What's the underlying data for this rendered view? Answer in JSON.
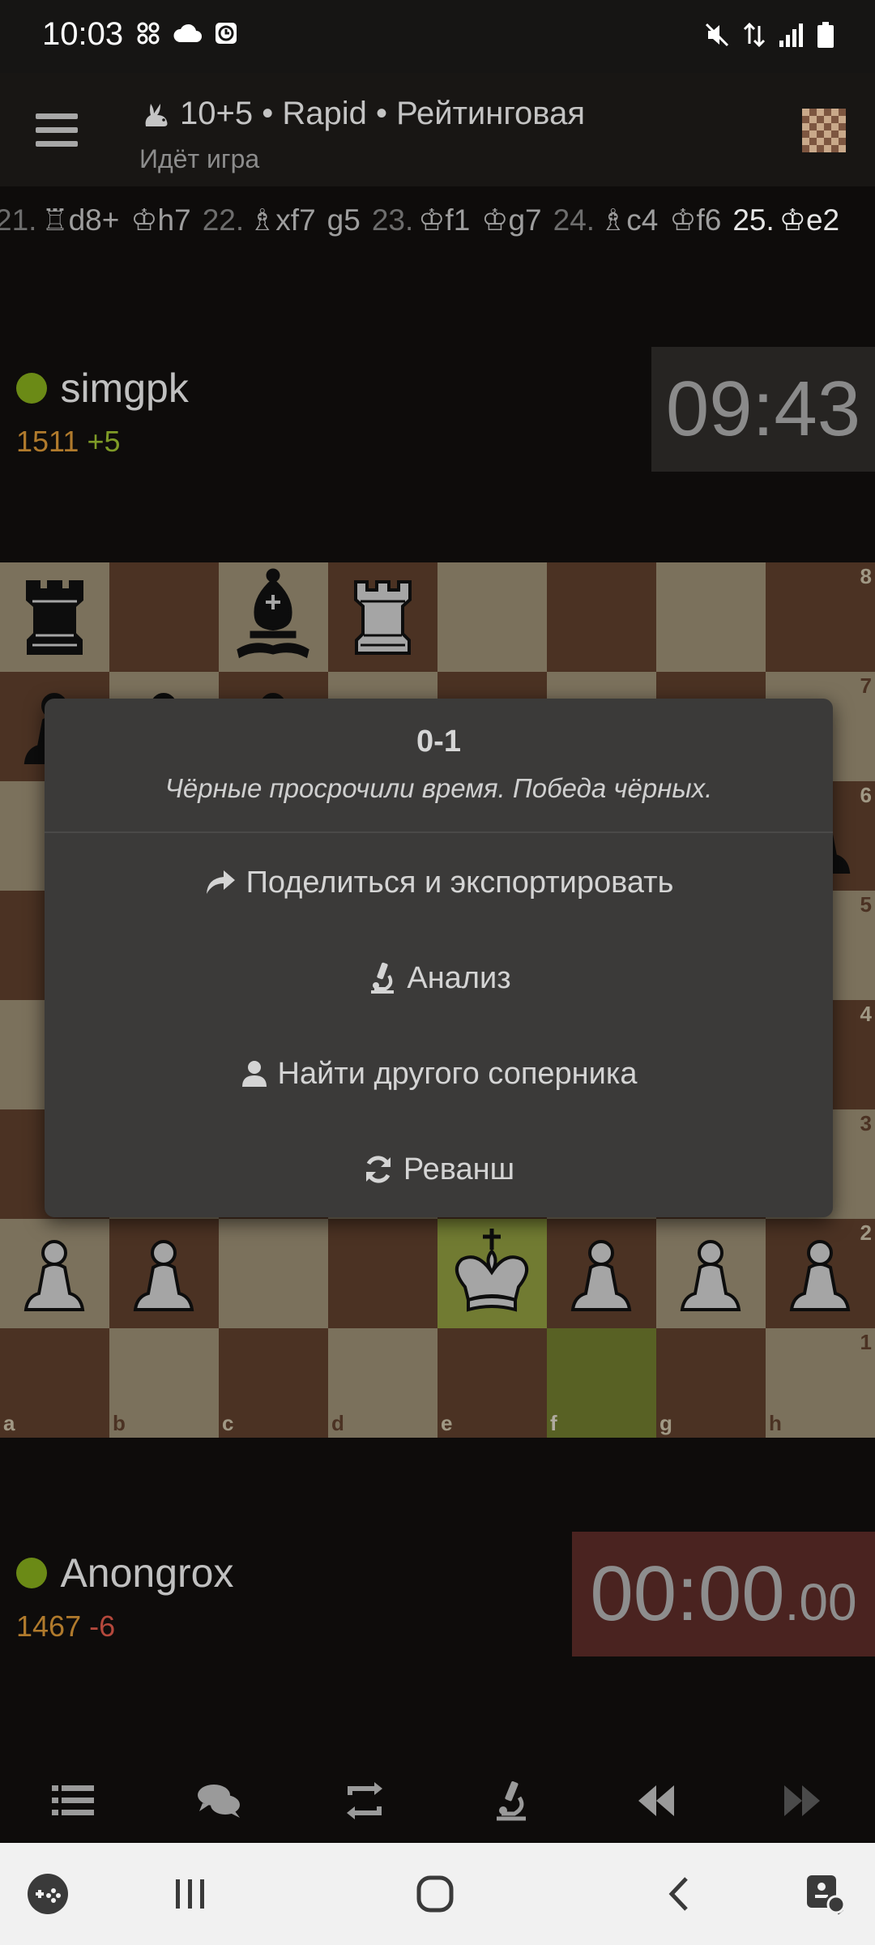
{
  "status_bar": {
    "time": "10:03"
  },
  "header": {
    "title": "10+5 • Rapid • Рейтинговая",
    "subtitle": "Идёт игра"
  },
  "moves": [
    {
      "num": "21.",
      "white": "♖d8+",
      "black": "♔h7"
    },
    {
      "num": "22.",
      "white": "♗xf7",
      "black": "g5"
    },
    {
      "num": "23.",
      "white": "♔f1",
      "black": "♔g7"
    },
    {
      "num": "24.",
      "white": "♗c4",
      "black": "♔f6"
    },
    {
      "num": "25.",
      "white": "♔e2",
      "black": ""
    }
  ],
  "top_player": {
    "name": "simgpk",
    "rating": "1511",
    "delta": "+5",
    "clock": "09:43"
  },
  "bottom_player": {
    "name": "Anongrox",
    "rating": "1467",
    "delta": "-6",
    "clock_main": "00:00",
    "clock_cent": ".00"
  },
  "board": {
    "files": [
      "a",
      "b",
      "c",
      "d",
      "e",
      "f",
      "g",
      "h"
    ],
    "ranks": [
      "8",
      "7",
      "6",
      "5",
      "4",
      "3",
      "2",
      "1"
    ]
  },
  "modal": {
    "result": "0-1",
    "reason": "Чёрные просрочили время. Победа чёрных.",
    "share_label": "Поделиться и экспортировать",
    "analysis_label": "Анализ",
    "new_opponent_label": "Найти другого соперника",
    "rematch_label": "Реванш"
  },
  "colors": {
    "accent_green": "#6b8a16",
    "rating_orange": "#b07a2c",
    "loss_red": "#b4483c"
  },
  "icons": {
    "bottom_bar": [
      "list-icon",
      "chat-icon",
      "flip-board-icon",
      "analysis-icon",
      "prev-icon",
      "next-icon"
    ],
    "nav_bar": [
      "game-launcher-icon",
      "recent-apps-icon",
      "home-icon",
      "back-icon",
      "accessibility-icon"
    ]
  }
}
